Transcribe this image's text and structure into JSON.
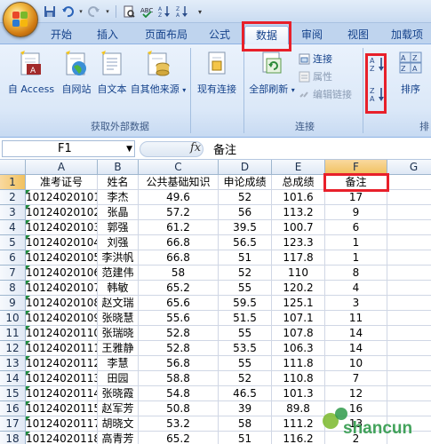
{
  "quick_access": {
    "icons": [
      "save-icon",
      "undo-icon",
      "redo-icon",
      "print-preview-icon",
      "spell-check-icon",
      "sort-asc-icon",
      "sort-desc-icon",
      "customize-icon"
    ]
  },
  "tabs": [
    "开始",
    "插入",
    "页面布局",
    "公式",
    "数据",
    "审阅",
    "视图",
    "加载项"
  ],
  "ribbon": {
    "external_data": {
      "access": "自 Access",
      "web": "自网站",
      "text": "自文本",
      "other": "自其他来源",
      "existing": "现有连接",
      "group_label": "获取外部数据"
    },
    "connections": {
      "refresh_all": "全部刷新",
      "connections": "连接",
      "properties": "属性",
      "edit_links": "编辑链接",
      "group_label": "连接"
    },
    "sort_filter": {
      "sort_az": "A Z",
      "sort_za": "Z A",
      "sort": "排序",
      "group_label": "排"
    }
  },
  "formula_bar": {
    "name_box": "F1",
    "fx": "fx",
    "formula": "备注"
  },
  "columns": [
    "A",
    "B",
    "C",
    "D",
    "E",
    "F",
    "G"
  ],
  "rows": [
    [
      "准考证号",
      "姓名",
      "公共基础知识",
      "申论成绩",
      "总成绩",
      "备注"
    ],
    [
      "10124020101",
      "李杰",
      "49.6",
      "52",
      "101.6",
      "17"
    ],
    [
      "10124020102",
      "张晶",
      "57.2",
      "56",
      "113.2",
      "9"
    ],
    [
      "10124020103",
      "郭强",
      "61.2",
      "39.5",
      "100.7",
      "6"
    ],
    [
      "10124020104",
      "刘强",
      "66.8",
      "56.5",
      "123.3",
      "1"
    ],
    [
      "10124020105",
      "李洪帆",
      "66.8",
      "51",
      "117.8",
      "1"
    ],
    [
      "10124020106",
      "范建伟",
      "58",
      "52",
      "110",
      "8"
    ],
    [
      "10124020107",
      "韩敏",
      "65.2",
      "55",
      "120.2",
      "4"
    ],
    [
      "10124020108",
      "赵文瑞",
      "65.6",
      "59.5",
      "125.1",
      "3"
    ],
    [
      "10124020109",
      "张晓慧",
      "55.6",
      "51.5",
      "107.1",
      "11"
    ],
    [
      "10124020110",
      "张瑞晓",
      "52.8",
      "55",
      "107.8",
      "14"
    ],
    [
      "10124020111",
      "王雅静",
      "52.8",
      "53.5",
      "106.3",
      "14"
    ],
    [
      "10124020112",
      "李慧",
      "56.8",
      "55",
      "111.8",
      "10"
    ],
    [
      "10124020113",
      "田园",
      "58.8",
      "52",
      "110.8",
      "7"
    ],
    [
      "10124020114",
      "张晓霞",
      "54.8",
      "46.5",
      "101.3",
      "12"
    ],
    [
      "10124020115",
      "赵军芳",
      "50.8",
      "39",
      "89.8",
      "16"
    ],
    [
      "10124020117",
      "胡晓文",
      "53.2",
      "58",
      "111.2",
      "13"
    ],
    [
      "10124020118",
      "高青芳",
      "65.2",
      "51",
      "116.2",
      "2"
    ]
  ],
  "watermark": "shancun",
  "colors": {
    "highlight": "#e8202a",
    "selected_header": "#f1c15f",
    "ribbon": "#dbe8f8"
  }
}
